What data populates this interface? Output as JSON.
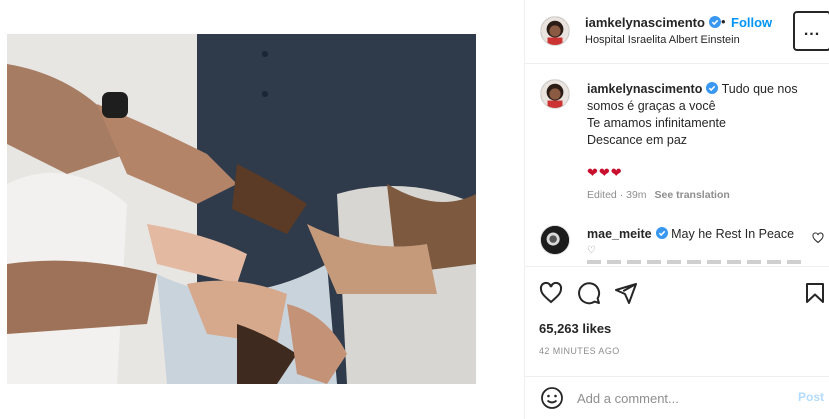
{
  "header": {
    "username": "iamkelynascimento",
    "separator": "•",
    "follow_label": "Follow",
    "location": "Hospital Israelita Albert Einstein",
    "more_label": "..."
  },
  "caption": {
    "username": "iamkelynascimento",
    "line1": "Tudo que nos",
    "line2": "somos é graças a você",
    "line3": "Te amamos infinitamente",
    "line4": "Descance em paz",
    "hearts": "❤❤❤",
    "edited": "Edited · 39m",
    "see_translation": "See translation"
  },
  "comment": {
    "username": "mae_meite",
    "text": "May he Rest In Peace",
    "sub": "♡"
  },
  "actions": {
    "likes": "65,263 likes",
    "time_ago": "42 MINUTES AGO"
  },
  "add_comment": {
    "placeholder": "Add a comment...",
    "post_label": "Post"
  },
  "colors": {
    "accent": "#0095f6",
    "verified": "#3897f0",
    "heart": "#c8102e"
  }
}
